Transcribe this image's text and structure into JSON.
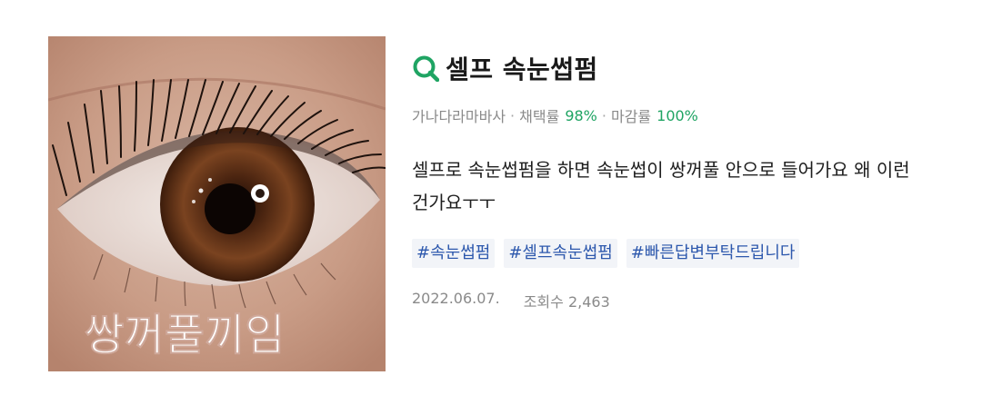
{
  "thumbnail": {
    "overlay_text": "쌍꺼풀끼임",
    "description_icon": "eye-photo"
  },
  "question": {
    "search_icon": "q-search-icon",
    "title": "셀프 속눈썹펌",
    "author": "가나다라마바사",
    "adoption_label": "채택률",
    "adoption_rate": "98%",
    "close_label": "마감률",
    "close_rate": "100%",
    "body": "셀프로 속눈썹펌을 하면 속눈썹이 쌍꺼풀 안으로 들어가요 왜 이런 건가요ㅜㅜ",
    "tags": [
      "#속눈썹펌",
      "#셀프속눈썹펌",
      "#빠른답변부탁드립니다"
    ],
    "date": "2022.06.07.",
    "views_label": "조회수",
    "views": "2,463"
  },
  "colors": {
    "accent_green": "#1fa463",
    "tag_blue": "#2d58ad",
    "tag_bg": "#f2f4f8"
  }
}
